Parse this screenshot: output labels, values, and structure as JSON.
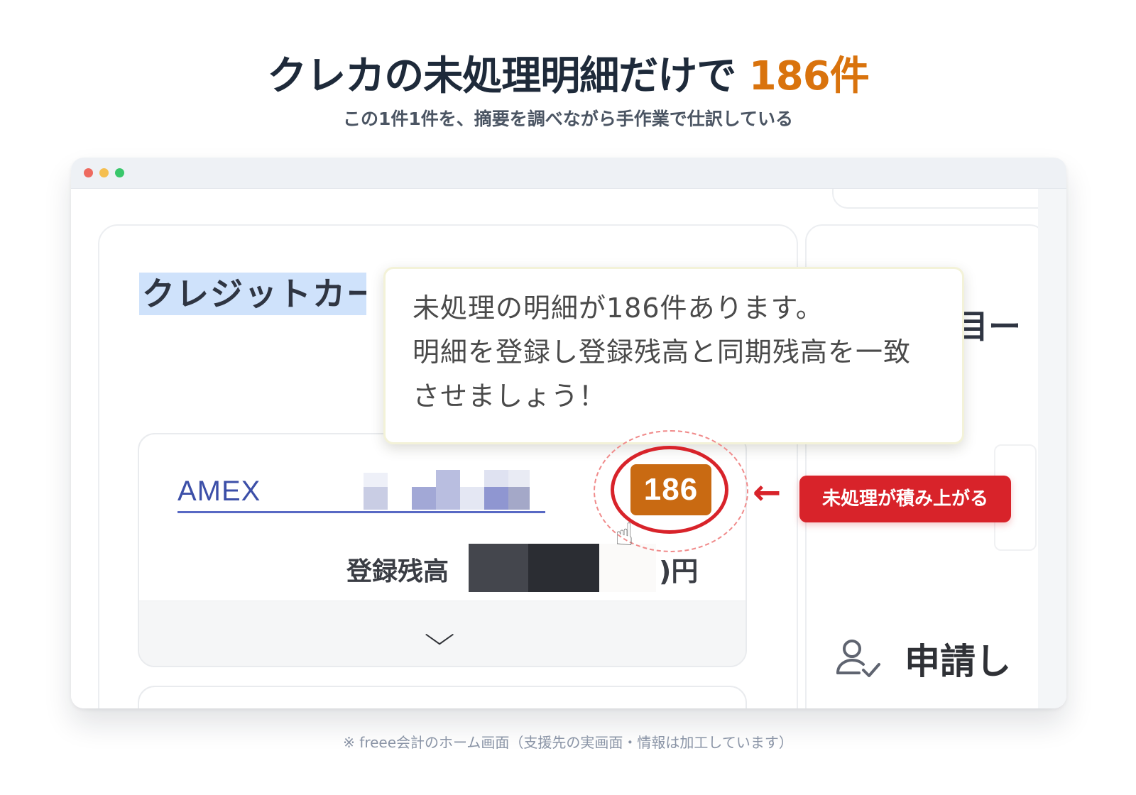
{
  "header": {
    "title": "クレカの未処理明細だけで",
    "title_highlight": "186件",
    "subtitle": "この1件1件を、摘要を調べながら手作業で仕訳している"
  },
  "screenshot": {
    "card_title": "クレジットカー",
    "right_cut_text": "目ー",
    "tooltip": {
      "line1": "未処理の明細が186件あります。",
      "line2": "明細を登録し登録残高と同期残高を一致",
      "line3": "させましょう！"
    },
    "account": {
      "name": "AMEX",
      "balance_label": "登録残高",
      "currency": ")円",
      "expand_icon": "chevron-down-icon"
    },
    "badge": {
      "count": "186",
      "color": "#c96a12"
    },
    "annotation": {
      "label": "未処理が積み上がる",
      "color": "#d8232a",
      "arrow_icon": "arrow-left-icon"
    },
    "apply": {
      "icon": "user-check-icon",
      "label": "申請し"
    }
  },
  "footnote": "※ freee会計のホーム画面（支援先の実画面・情報は加工しています）",
  "colors": {
    "accent": "#d9730d",
    "heading": "#1e2a3a"
  }
}
